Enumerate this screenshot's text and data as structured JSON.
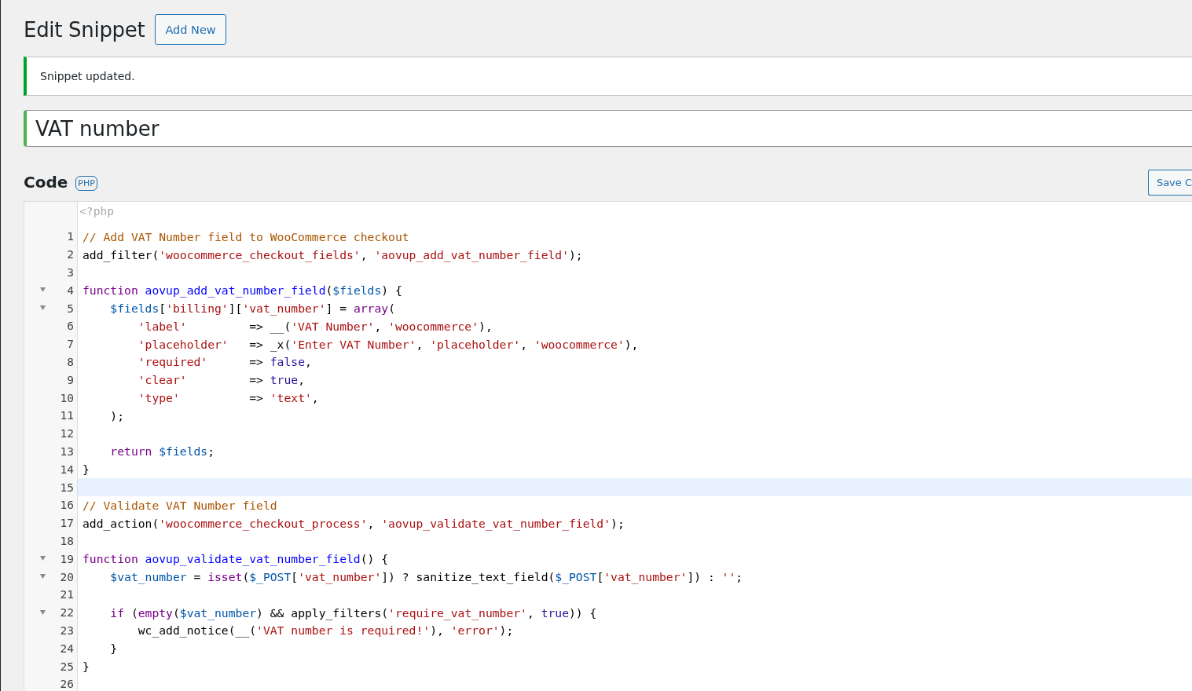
{
  "page": {
    "title": "Edit Snippet",
    "add_new": "Add New"
  },
  "notice": {
    "text": "Snippet updated."
  },
  "title_field": {
    "value": "VAT number"
  },
  "code_section": {
    "heading": "Code",
    "language": "PHP",
    "save_button": "Save C"
  },
  "editor": {
    "header": "<?php",
    "lines": [
      {
        "number": "1",
        "foldable": false,
        "active": false,
        "tokens": [
          {
            "kind": "comment",
            "text": "// Add VAT Number field to WooCommerce checkout"
          }
        ]
      },
      {
        "number": "2",
        "foldable": false,
        "active": false,
        "tokens": [
          {
            "kind": "plain",
            "text": "add_filter("
          },
          {
            "kind": "string",
            "text": "'woocommerce_checkout_fields'"
          },
          {
            "kind": "plain",
            "text": ", "
          },
          {
            "kind": "string",
            "text": "'aovup_add_vat_number_field'"
          },
          {
            "kind": "plain",
            "text": ");"
          }
        ]
      },
      {
        "number": "3",
        "foldable": false,
        "active": false
      },
      {
        "number": "4",
        "foldable": true,
        "active": false,
        "tokens": [
          {
            "kind": "keyword",
            "text": "function "
          },
          {
            "kind": "def",
            "text": "aovup_add_vat_number_field"
          },
          {
            "kind": "plain",
            "text": "("
          },
          {
            "kind": "variable",
            "text": "$fields"
          },
          {
            "kind": "plain",
            "text": ") {"
          }
        ]
      },
      {
        "number": "5",
        "foldable": true,
        "active": false,
        "tokens": [
          {
            "kind": "variable",
            "text": "    $fields"
          },
          {
            "kind": "plain",
            "text": "["
          },
          {
            "kind": "string",
            "text": "'billing'"
          },
          {
            "kind": "plain",
            "text": "]["
          },
          {
            "kind": "string",
            "text": "'vat_number'"
          },
          {
            "kind": "plain",
            "text": "] = "
          },
          {
            "kind": "keyword",
            "text": "array"
          },
          {
            "kind": "plain",
            "text": "("
          }
        ]
      },
      {
        "number": "6",
        "foldable": false,
        "active": false,
        "tokens": [
          {
            "kind": "string",
            "text": "        'label'"
          },
          {
            "kind": "plain",
            "text": "         => __("
          },
          {
            "kind": "string",
            "text": "'VAT Number'"
          },
          {
            "kind": "plain",
            "text": ", "
          },
          {
            "kind": "string",
            "text": "'woocommerce'"
          },
          {
            "kind": "plain",
            "text": "),"
          }
        ]
      },
      {
        "number": "7",
        "foldable": false,
        "active": false,
        "tokens": [
          {
            "kind": "string",
            "text": "        'placeholder'"
          },
          {
            "kind": "plain",
            "text": "   => _x("
          },
          {
            "kind": "string",
            "text": "'Enter VAT Number'"
          },
          {
            "kind": "plain",
            "text": ", "
          },
          {
            "kind": "string",
            "text": "'placeholder'"
          },
          {
            "kind": "plain",
            "text": ", "
          },
          {
            "kind": "string",
            "text": "'woocommerce'"
          },
          {
            "kind": "plain",
            "text": "),"
          }
        ]
      },
      {
        "number": "8",
        "foldable": false,
        "active": false,
        "tokens": [
          {
            "kind": "string",
            "text": "        'required'"
          },
          {
            "kind": "plain",
            "text": "      => "
          },
          {
            "kind": "atom",
            "text": "false"
          },
          {
            "kind": "plain",
            "text": ","
          }
        ]
      },
      {
        "number": "9",
        "foldable": false,
        "active": false,
        "tokens": [
          {
            "kind": "string",
            "text": "        'clear'"
          },
          {
            "kind": "plain",
            "text": "         => "
          },
          {
            "kind": "atom",
            "text": "true"
          },
          {
            "kind": "plain",
            "text": ","
          }
        ]
      },
      {
        "number": "10",
        "foldable": false,
        "active": false,
        "tokens": [
          {
            "kind": "string",
            "text": "        'type'"
          },
          {
            "kind": "plain",
            "text": "          => "
          },
          {
            "kind": "string",
            "text": "'text'"
          },
          {
            "kind": "plain",
            "text": ","
          }
        ]
      },
      {
        "number": "11",
        "foldable": false,
        "active": false,
        "tokens": [
          {
            "kind": "plain",
            "text": "    );"
          }
        ]
      },
      {
        "number": "12",
        "foldable": false,
        "active": false
      },
      {
        "number": "13",
        "foldable": false,
        "active": false,
        "tokens": [
          {
            "kind": "keyword",
            "text": "    return "
          },
          {
            "kind": "variable",
            "text": "$fields"
          },
          {
            "kind": "plain",
            "text": ";"
          }
        ]
      },
      {
        "number": "14",
        "foldable": false,
        "active": false,
        "tokens": [
          {
            "kind": "plain",
            "text": "}"
          }
        ]
      },
      {
        "number": "15",
        "foldable": false,
        "active": true
      },
      {
        "number": "16",
        "foldable": false,
        "active": false,
        "tokens": [
          {
            "kind": "comment",
            "text": "// Validate VAT Number field"
          }
        ]
      },
      {
        "number": "17",
        "foldable": false,
        "active": false,
        "tokens": [
          {
            "kind": "plain",
            "text": "add_action("
          },
          {
            "kind": "string",
            "text": "'woocommerce_checkout_process'"
          },
          {
            "kind": "plain",
            "text": ", "
          },
          {
            "kind": "string",
            "text": "'aovup_validate_vat_number_field'"
          },
          {
            "kind": "plain",
            "text": ");"
          }
        ]
      },
      {
        "number": "18",
        "foldable": false,
        "active": false
      },
      {
        "number": "19",
        "foldable": true,
        "active": false,
        "tokens": [
          {
            "kind": "keyword",
            "text": "function "
          },
          {
            "kind": "def",
            "text": "aovup_validate_vat_number_field"
          },
          {
            "kind": "plain",
            "text": "() {"
          }
        ]
      },
      {
        "number": "20",
        "foldable": true,
        "active": false,
        "tokens": [
          {
            "kind": "variable",
            "text": "    $vat_number"
          },
          {
            "kind": "plain",
            "text": " = "
          },
          {
            "kind": "keyword",
            "text": "isset"
          },
          {
            "kind": "plain",
            "text": "("
          },
          {
            "kind": "variable",
            "text": "$_POST"
          },
          {
            "kind": "plain",
            "text": "["
          },
          {
            "kind": "string",
            "text": "'vat_number'"
          },
          {
            "kind": "plain",
            "text": "]) ? sanitize_text_field("
          },
          {
            "kind": "variable",
            "text": "$_POST"
          },
          {
            "kind": "plain",
            "text": "["
          },
          {
            "kind": "string",
            "text": "'vat_number'"
          },
          {
            "kind": "plain",
            "text": "]) : "
          },
          {
            "kind": "string",
            "text": "''"
          },
          {
            "kind": "plain",
            "text": ";"
          }
        ]
      },
      {
        "number": "21",
        "foldable": false,
        "active": false
      },
      {
        "number": "22",
        "foldable": true,
        "active": false,
        "tokens": [
          {
            "kind": "keyword",
            "text": "    if"
          },
          {
            "kind": "plain",
            "text": " ("
          },
          {
            "kind": "keyword",
            "text": "empty"
          },
          {
            "kind": "plain",
            "text": "("
          },
          {
            "kind": "variable",
            "text": "$vat_number"
          },
          {
            "kind": "plain",
            "text": ") && apply_filters("
          },
          {
            "kind": "string",
            "text": "'require_vat_number'"
          },
          {
            "kind": "plain",
            "text": ", "
          },
          {
            "kind": "atom",
            "text": "true"
          },
          {
            "kind": "plain",
            "text": ")) {"
          }
        ]
      },
      {
        "number": "23",
        "foldable": false,
        "active": false,
        "tokens": [
          {
            "kind": "plain",
            "text": "        wc_add_notice(__("
          },
          {
            "kind": "string",
            "text": "'VAT number is required!'"
          },
          {
            "kind": "plain",
            "text": "), "
          },
          {
            "kind": "string",
            "text": "'error'"
          },
          {
            "kind": "plain",
            "text": ");"
          }
        ]
      },
      {
        "number": "24",
        "foldable": false,
        "active": false,
        "tokens": [
          {
            "kind": "plain",
            "text": "    }"
          }
        ]
      },
      {
        "number": "25",
        "foldable": false,
        "active": false,
        "tokens": [
          {
            "kind": "plain",
            "text": "}"
          }
        ]
      },
      {
        "number": "26",
        "foldable": false,
        "active": false
      }
    ]
  }
}
